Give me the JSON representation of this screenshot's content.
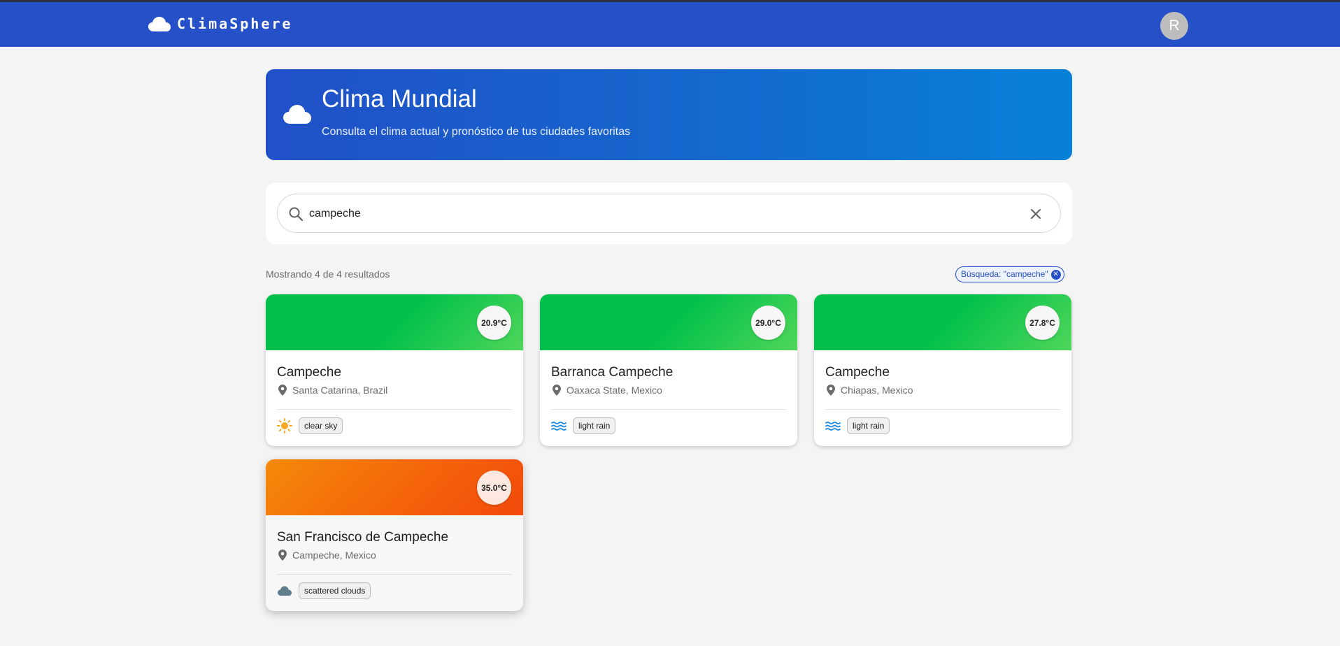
{
  "header": {
    "brand": "ClimaSphere",
    "avatar_initial": "R"
  },
  "hero": {
    "title": "Clima Mundial",
    "subtitle": "Consulta el clima actual y pronóstico de tus ciudades favoritas"
  },
  "search": {
    "value": "campeche",
    "placeholder": ""
  },
  "results": {
    "count_text": "Mostrando 4 de 4 resultados",
    "filter_chip": "Búsqueda: \"campeche\""
  },
  "cities": [
    {
      "name": "Campeche",
      "location": "Santa Catarina, Brazil",
      "temp": "20.9°C",
      "condition": "clear sky",
      "icon": "sun-icon"
    },
    {
      "name": "Barranca Campeche",
      "location": "Oaxaca State, Mexico",
      "temp": "29.0°C",
      "condition": "light rain",
      "icon": "waves-icon"
    },
    {
      "name": "Campeche",
      "location": "Chiapas, Mexico",
      "temp": "27.8°C",
      "condition": "light rain",
      "icon": "waves-icon"
    },
    {
      "name": "San Francisco de Campeche",
      "location": "Campeche, Mexico",
      "temp": "35.0°C",
      "condition": "scattered clouds",
      "icon": "cloud-icon"
    }
  ],
  "colors": {
    "primary": "#2550c8",
    "band_mild": "#00c04a",
    "band_hot": "#f4640a"
  }
}
